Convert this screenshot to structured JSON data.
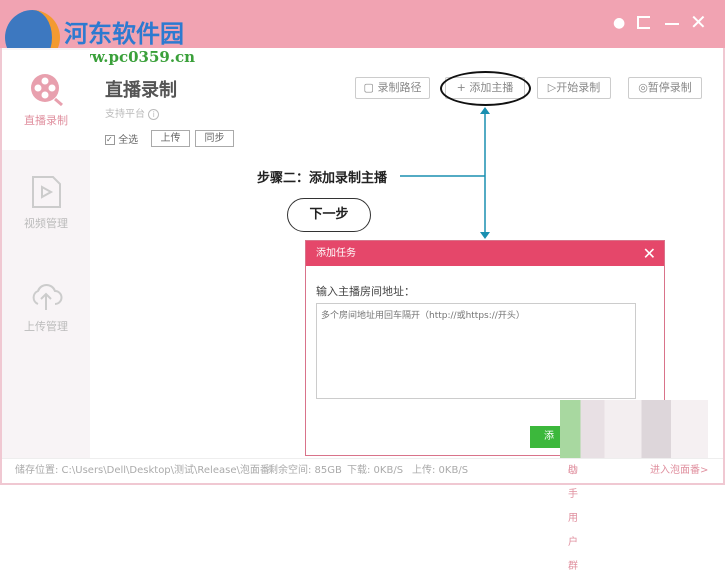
{
  "watermark": {
    "name": "河东软件园",
    "url": "www.pc0359.cn"
  },
  "window_controls": [
    "user-icon",
    "logout-icon",
    "minimize-icon",
    "close-icon"
  ],
  "sidebar": {
    "items": [
      {
        "label": "直播录制",
        "icon": "film-reel-icon"
      },
      {
        "label": "视频管理",
        "icon": "video-file-icon"
      },
      {
        "label": "上传管理",
        "icon": "cloud-upload-icon"
      }
    ]
  },
  "main": {
    "title": "直播录制",
    "platform_label": "支持平台",
    "select_all": "全选",
    "upload": "上传",
    "sync": "同步",
    "toolbar": {
      "record_path": "录制路径",
      "add_streamer": "添加主播",
      "start_record": "开始录制",
      "pause_record": "暂停录制"
    }
  },
  "annotation": {
    "step": "步骤二：添加录制主播",
    "next": "下一步"
  },
  "dialog": {
    "title": "添加任务",
    "label": "输入主播房间地址：",
    "placeholder": "多个房间地址用回车隔开（http://或https://开头）",
    "confirm": "添"
  },
  "status": {
    "storage": "储存位置: C:\\Users\\Dell\\Desktop\\测试\\Release\\泡面番",
    "free": "剩余空间: 85GB",
    "download": "下载: 0KB/S",
    "upload": "上传: 0KB/S",
    "help": "助手用户群",
    "enter": "进入泡面番>"
  },
  "colors": {
    "titlebar": "#f1a3b2",
    "dialog_header": "#e5476a",
    "accent_line": "#1a8fb0",
    "confirm": "#3cb83c"
  }
}
